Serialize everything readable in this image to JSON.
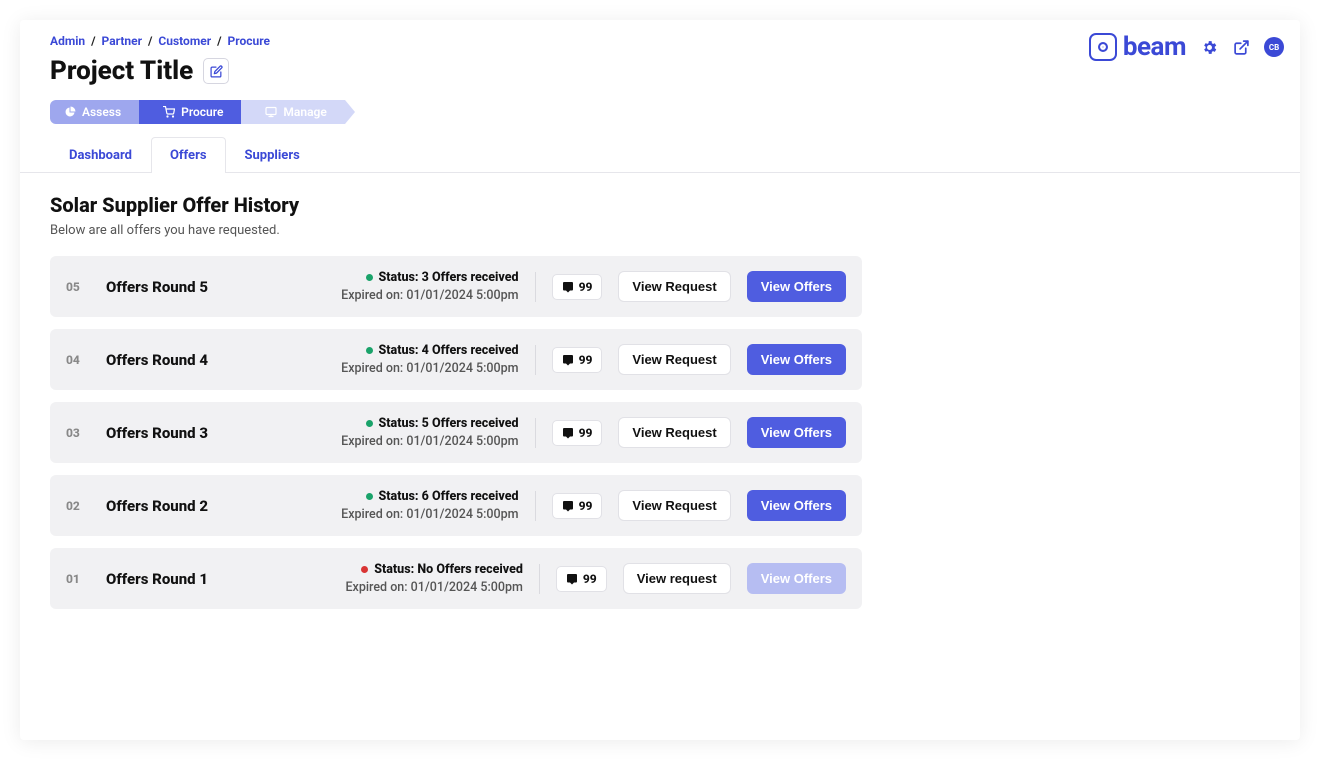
{
  "brand": {
    "text": "beam"
  },
  "avatar_initials": "CB",
  "breadcrumb": {
    "items": [
      "Admin",
      "Partner",
      "Customer",
      "Procure"
    ]
  },
  "page_title": "Project Title",
  "wizard": {
    "steps": [
      "Assess",
      "Procure",
      "Manage"
    ],
    "active_index": 1
  },
  "tabs": {
    "items": [
      "Dashboard",
      "Offers",
      "Suppliers"
    ],
    "active_index": 1
  },
  "section": {
    "title": "Solar Supplier Offer History",
    "subtitle": "Below are all offers you have requested."
  },
  "common": {
    "expired_label": "Expired on:",
    "status_label": "Status:",
    "view_request_label": "View Request",
    "view_request_label_alt": "View request",
    "view_offers_label": "View Offers"
  },
  "offers": [
    {
      "num": "05",
      "title": "Offers Round 5",
      "status_text": "3 Offers received",
      "status_color": "green",
      "expired": "01/01/2024 5:00pm",
      "chat_count": "99",
      "offers_enabled": true
    },
    {
      "num": "04",
      "title": "Offers Round 4",
      "status_text": "4 Offers received",
      "status_color": "green",
      "expired": "01/01/2024 5:00pm",
      "chat_count": "99",
      "offers_enabled": true
    },
    {
      "num": "03",
      "title": "Offers Round 3",
      "status_text": "5 Offers received",
      "status_color": "green",
      "expired": "01/01/2024 5:00pm",
      "chat_count": "99",
      "offers_enabled": true
    },
    {
      "num": "02",
      "title": "Offers Round 2",
      "status_text": "6 Offers received",
      "status_color": "green",
      "expired": "01/01/2024 5:00pm",
      "chat_count": "99",
      "offers_enabled": true
    },
    {
      "num": "01",
      "title": "Offers Round 1",
      "status_text": "No Offers received",
      "status_color": "red",
      "expired": "01/01/2024 5:00pm",
      "chat_count": "99",
      "offers_enabled": false
    }
  ]
}
